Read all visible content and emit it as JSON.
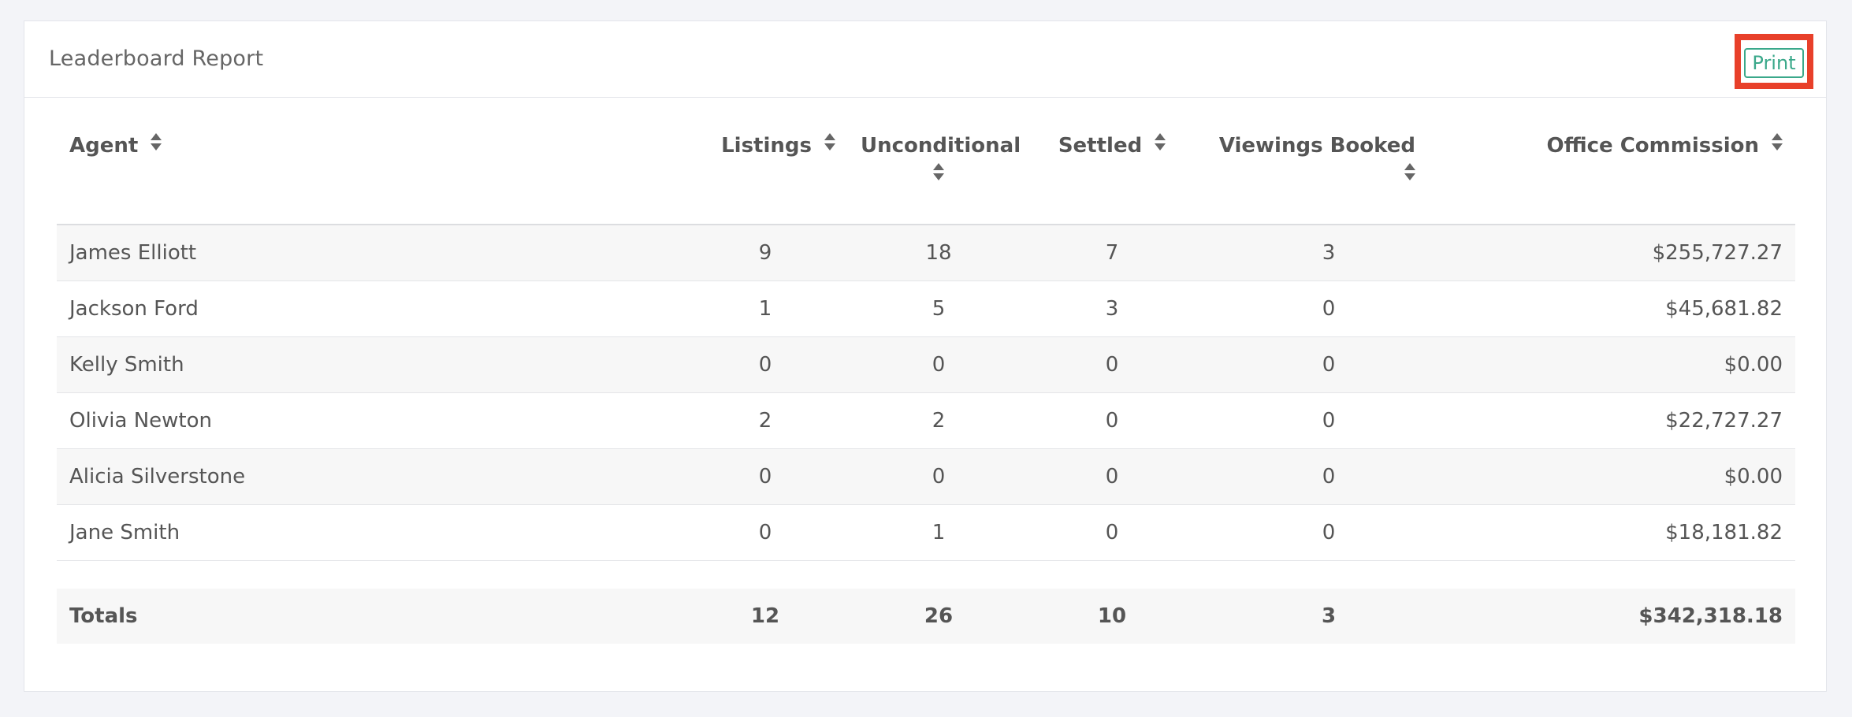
{
  "header": {
    "title": "Leaderboard Report",
    "print_label": "Print"
  },
  "table": {
    "columns": [
      "Agent",
      "Listings",
      "Unconditional",
      "Settled",
      "Viewings Booked",
      "Office Commission"
    ],
    "rows": [
      {
        "agent": "James Elliott",
        "listings": "9",
        "unconditional": "18",
        "settled": "7",
        "viewings": "3",
        "commission": "$255,727.27"
      },
      {
        "agent": "Jackson Ford",
        "listings": "1",
        "unconditional": "5",
        "settled": "3",
        "viewings": "0",
        "commission": "$45,681.82"
      },
      {
        "agent": "Kelly Smith",
        "listings": "0",
        "unconditional": "0",
        "settled": "0",
        "viewings": "0",
        "commission": "$0.00"
      },
      {
        "agent": "Olivia Newton",
        "listings": "2",
        "unconditional": "2",
        "settled": "0",
        "viewings": "0",
        "commission": "$22,727.27"
      },
      {
        "agent": "Alicia Silverstone",
        "listings": "0",
        "unconditional": "0",
        "settled": "0",
        "viewings": "0",
        "commission": "$0.00"
      },
      {
        "agent": "Jane Smith",
        "listings": "0",
        "unconditional": "1",
        "settled": "0",
        "viewings": "0",
        "commission": "$18,181.82"
      }
    ],
    "totals": {
      "label": "Totals",
      "listings": "12",
      "unconditional": "26",
      "settled": "10",
      "viewings": "3",
      "commission": "$342,318.18"
    }
  },
  "colors": {
    "accent": "#3aa88a",
    "highlight_border": "#e8402a",
    "page_background": "#f3f4f8"
  }
}
